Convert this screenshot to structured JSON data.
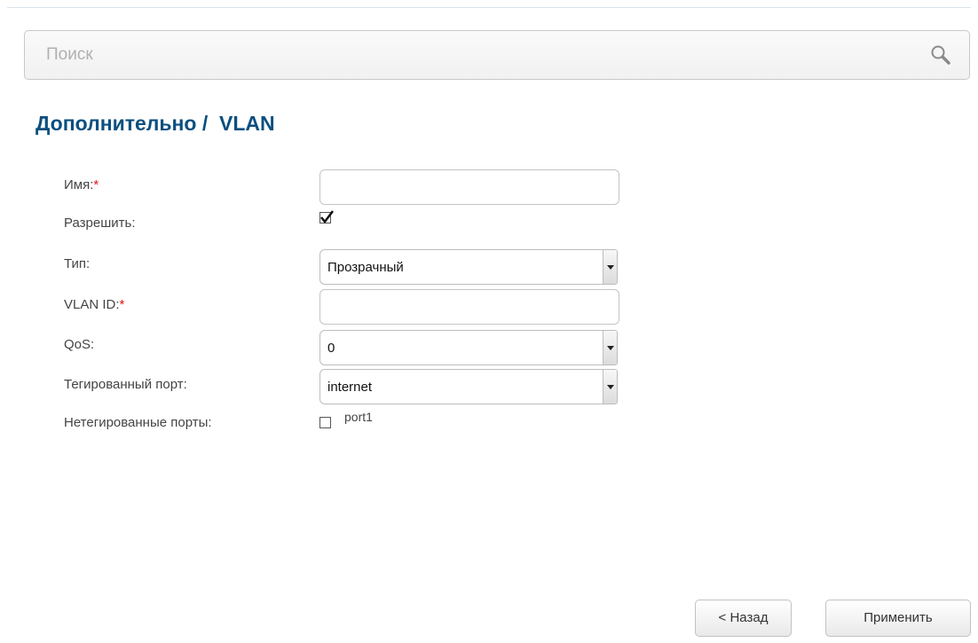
{
  "search": {
    "placeholder": "Поиск",
    "icon": "search-icon"
  },
  "page": {
    "title": "Дополнительно /  VLAN"
  },
  "form": {
    "name": {
      "label": "Имя:",
      "required_mark": "*",
      "value": ""
    },
    "enable": {
      "label": "Разрешить:",
      "checked": true
    },
    "type": {
      "label": "Тип:",
      "value": "Прозрачный"
    },
    "vlan_id": {
      "label": "VLAN ID:",
      "required_mark": "*",
      "value": ""
    },
    "qos": {
      "label": "QoS:",
      "value": "0"
    },
    "tagged_port": {
      "label": "Тегированный порт:",
      "value": "internet"
    },
    "untagged_ports": {
      "label": "Нетегированные порты:",
      "options": [
        {
          "label": "port1",
          "checked": false
        }
      ]
    }
  },
  "buttons": {
    "back": "< Назад",
    "apply": "Применить"
  },
  "colors": {
    "title": "#0b4f7f",
    "required": "#e01010"
  }
}
